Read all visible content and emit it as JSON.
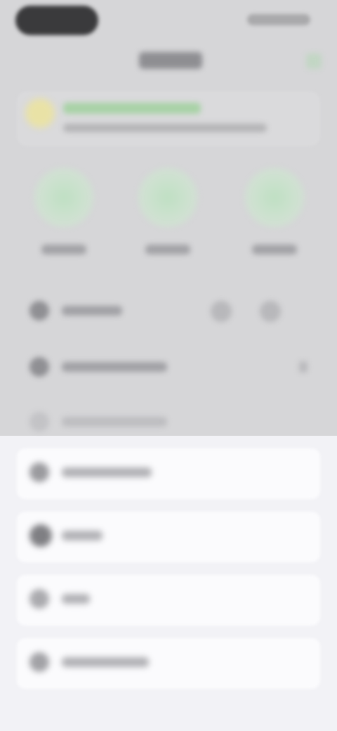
{
  "status_bar": {
    "time": "",
    "indicators": ""
  },
  "nav": {
    "title": "",
    "action_icon": "check-icon"
  },
  "banner": {
    "title": "",
    "subtitle": "",
    "icon": "lightbulb-icon"
  },
  "quick_actions": [
    {
      "label": "",
      "icon": "phone-icon"
    },
    {
      "label": "",
      "icon": "message-icon"
    },
    {
      "label": "",
      "icon": "video-icon"
    }
  ],
  "rows": [
    {
      "label": "",
      "icon": "contact-icon"
    },
    {
      "label": "",
      "icon": "clock-icon"
    },
    {
      "label": "",
      "icon": "note-icon"
    }
  ],
  "lower_rows": [
    {
      "label": "",
      "icon": "share-icon"
    },
    {
      "label": "",
      "icon": "block-icon"
    },
    {
      "label": "",
      "icon": "star-icon"
    },
    {
      "label": "",
      "icon": "info-icon"
    }
  ],
  "colors": {
    "top_background": "#d6d6d8",
    "bottom_background": "#f2f2f6",
    "accent_green": "#a8d2a6",
    "banner_icon": "#e9e2a6"
  }
}
